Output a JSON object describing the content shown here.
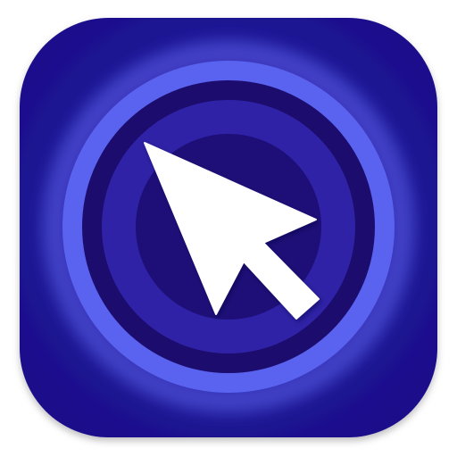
{
  "app_icon": {
    "icon": "cursor-target-icon",
    "colors": {
      "tile_center": "#2a1fb0",
      "tile_edge": "#1a0f8a",
      "outer_ring": "#5a63f0",
      "outer_ring_glow": "#6b74ff",
      "dark_band": "#1c0c6e",
      "middle_ring": "#2f22a6",
      "inner_disc": "#1e0f78",
      "cursor": "#ffffff"
    }
  }
}
